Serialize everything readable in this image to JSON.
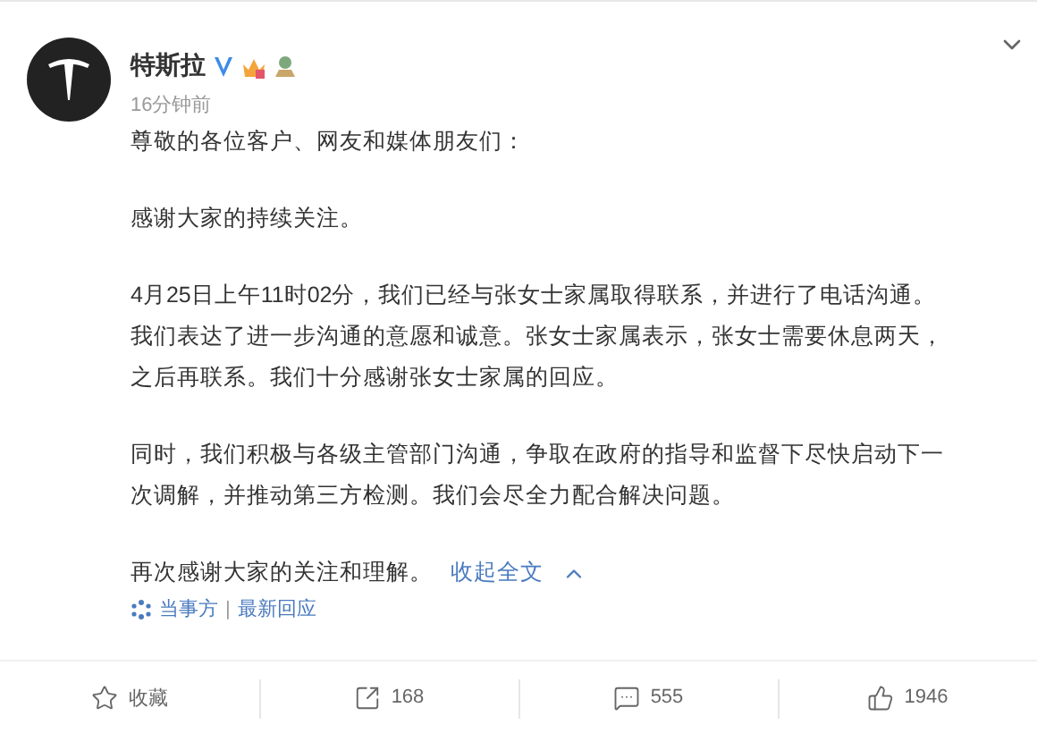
{
  "post": {
    "author": "特斯拉",
    "time": "16分钟前",
    "paragraphs": [
      [
        "尊敬的各位客户、网友和媒体朋友们："
      ],
      [
        "感谢大家的持续关注。"
      ],
      [
        "4月25日上午11时02分，我们已经与张女士家属取得联系，并进行了电话沟通。",
        "我们表达了进一步沟通的意愿和诚意。张女士家属表示，张女士需要休息两天，",
        "之后再联系。我们十分感谢张女士家属的回应。"
      ],
      [
        "同时，我们积极与各级主管部门沟通，争取在政府的指导和监督下尽快启动下一",
        "次调解，并推动第三方检测。我们会尽全力配合解决问题。"
      ]
    ],
    "closing": "再次感谢大家的关注和理解。",
    "collapse_link": "收起全文",
    "links": [
      "当事方",
      "最新回应"
    ],
    "link_separator": "|"
  },
  "actions": [
    {
      "kind": "favorite",
      "label": "收藏"
    },
    {
      "kind": "repost",
      "label": "168"
    },
    {
      "kind": "comment",
      "label": "555"
    },
    {
      "kind": "like",
      "label": "1946"
    }
  ]
}
